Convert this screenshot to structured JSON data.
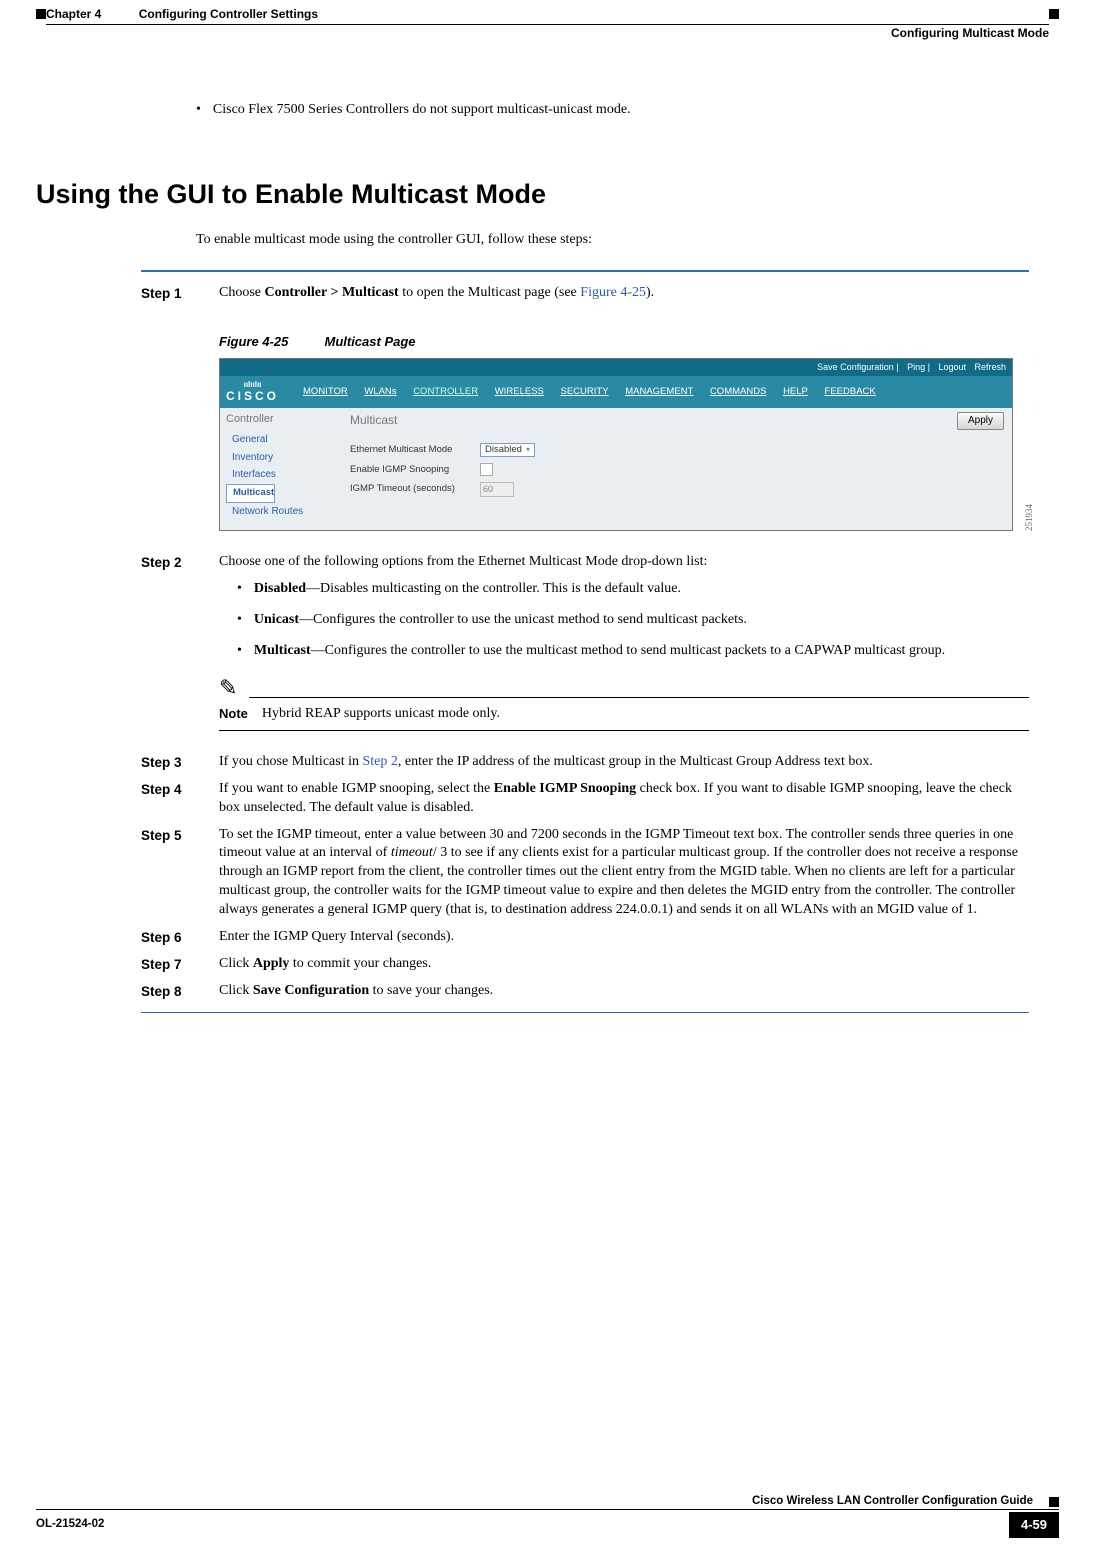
{
  "header": {
    "chapter": "Chapter 4",
    "chapter_title": "Configuring Controller Settings",
    "section": "Configuring Multicast Mode"
  },
  "intro_bullet": "Cisco Flex 7500 Series Controllers do not support multicast-unicast mode.",
  "heading": "Using the GUI to Enable Multicast Mode",
  "intro2": "To enable multicast mode using the controller GUI, follow these steps:",
  "steps": {
    "s1": {
      "label": "Step 1",
      "pre": "Choose ",
      "bold": "Controller > Multicast",
      "post": " to open the Multicast page (see ",
      "linktext": "Figure 4-25",
      "post2": ")."
    },
    "figcaption": {
      "num": "Figure 4-25",
      "title": "Multicast Page"
    },
    "s2": {
      "label": "Step 2",
      "text": "Choose one of the following options from the Ethernet Multicast Mode drop-down list:",
      "b1_b": "Disabled",
      "b1_t": "—Disables multicasting on the controller. This is the default value.",
      "b2_b": "Unicast",
      "b2_t": "—Configures the controller to use the unicast method to send multicast packets.",
      "b3_b": "Multicast",
      "b3_t": "—Configures the controller to use the multicast method to send multicast packets to a CAPWAP multicast group.",
      "note_label": "Note",
      "note_text": "Hybrid REAP supports unicast mode only."
    },
    "s3": {
      "label": "Step 3",
      "pre": "If you chose Multicast in ",
      "link": "Step 2",
      "post": ", enter the IP address of the multicast group in the Multicast Group Address text box."
    },
    "s4": {
      "label": "Step 4",
      "pre": "If you want to enable IGMP snooping, select the ",
      "bold": "Enable IGMP Snooping",
      "post": " check box. If you want to disable IGMP snooping, leave the check box unselected. The default value is disabled."
    },
    "s5": {
      "label": "Step 5",
      "pre": "To set the IGMP timeout, enter a value between 30 and 7200 seconds in the IGMP Timeout text box. The controller sends three queries in one timeout value at an interval of ",
      "ital": "timeout",
      "post": "/ 3 to see if any clients exist for a particular multicast group. If the controller does not receive a response through an IGMP report from the client, the controller times out the client entry from the MGID table. When no clients are left for a particular multicast group, the controller waits for the IGMP timeout value to expire and then deletes the MGID entry from the controller. The controller always generates a general IGMP query (that is, to destination address 224.0.0.1) and sends it on all WLANs with an MGID value of 1."
    },
    "s6": {
      "label": "Step 6",
      "text": "Enter the IGMP Query Interval (seconds)."
    },
    "s7": {
      "label": "Step 7",
      "pre": "Click ",
      "bold": "Apply",
      "post": " to commit your changes."
    },
    "s8": {
      "label": "Step 8",
      "pre": "Click ",
      "bold": "Save Configuration",
      "post": " to save your changes."
    }
  },
  "gui": {
    "toplinks": {
      "a": "Save Configuration",
      "b": "Ping",
      "c": "Logout",
      "d": "Refresh"
    },
    "logo": "CISCO",
    "menu": [
      "MONITOR",
      "WLANs",
      "CONTROLLER",
      "WIRELESS",
      "SECURITY",
      "MANAGEMENT",
      "COMMANDS",
      "HELP",
      "FEEDBACK"
    ],
    "side_hdr": "Controller",
    "side": [
      "General",
      "Inventory",
      "Interfaces",
      "Multicast",
      "Network Routes"
    ],
    "main_title": "Multicast",
    "apply": "Apply",
    "r1_label": "Ethernet Multicast Mode",
    "r1_value": "Disabled",
    "r2_label": "Enable IGMP Snooping",
    "r3_label": "IGMP Timeout (seconds)",
    "r3_value": "60",
    "figcode": "251934"
  },
  "footer": {
    "guide": "Cisco Wireless LAN Controller Configuration Guide",
    "docid": "OL-21524-02",
    "page": "4-59"
  }
}
